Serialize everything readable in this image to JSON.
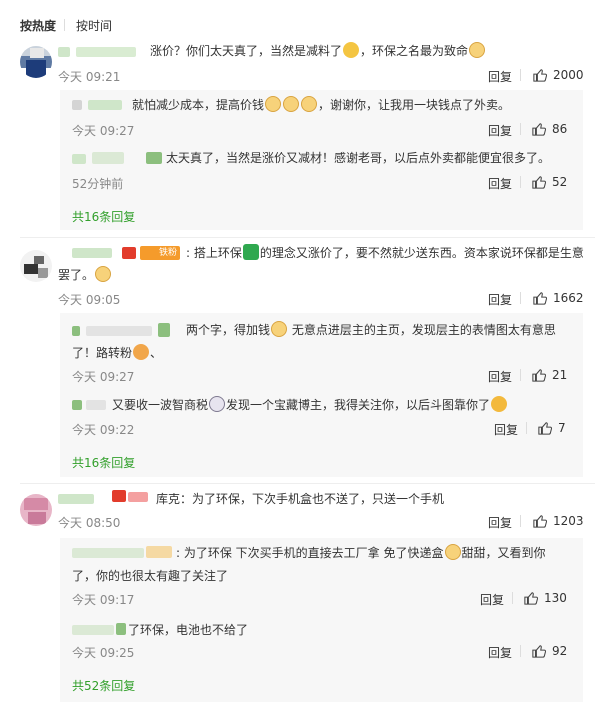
{
  "sort": {
    "hot": "按热度",
    "time": "按时间"
  },
  "reply_label": "回复",
  "threads": [
    {
      "text": "涨价？你们太天真了，当然是减料了",
      "text_tail": "，环保之名最为致命",
      "time": "今天 09:21",
      "likes": "2000",
      "replies": [
        {
          "text": "就怕减少成本，提高价钱",
          "text_tail": "，谢谢你，让我用一块钱点了外卖。",
          "time": "今天 09:27",
          "likes": "86"
        },
        {
          "text": "太天真了，当然是涨价又减材！感谢老哥，以后点外卖都能便宜很多了。",
          "time": "52分钟前",
          "likes": "52"
        }
      ],
      "more": "共16条回复"
    },
    {
      "text": "搭上环保",
      "text_tail": "的理念又涨价了，要不然就少送东西。资本家说环保都是生意",
      "text_line2": "罢了。",
      "badge": "铁粉",
      "time": "今天 09:05",
      "likes": "1662",
      "replies": [
        {
          "text": "两个字，得加钱",
          "text_tail": "无意点进层主的主页，发现层主的表情图太有意思",
          "text_line2": "了！路转粉",
          "text_line2_tail": "、",
          "time": "今天 09:27",
          "likes": "21"
        },
        {
          "text": "又要收一波智商税",
          "text_tail": "发现一个宝藏博主，我得关注你，以后斗图靠你了",
          "time": "今天 09:22",
          "likes": "7"
        }
      ],
      "more": "共16条回复"
    },
    {
      "text": "库克：为了环保，下次手机盒也不送了，只送一个手机",
      "time": "今天 08:50",
      "likes": "1203",
      "replies": [
        {
          "text": "为了环保 下次买手机的直接去工厂拿 免了快递盒",
          "text_tail": "甜甜，又看到你",
          "text_line2": "了，你的也很太有趣了关注了",
          "time": "今天 09:17",
          "likes": "130"
        },
        {
          "text": "了环保，电池也不给了",
          "time": "今天 09:25",
          "likes": "92"
        }
      ],
      "more": "共52条回复"
    }
  ]
}
